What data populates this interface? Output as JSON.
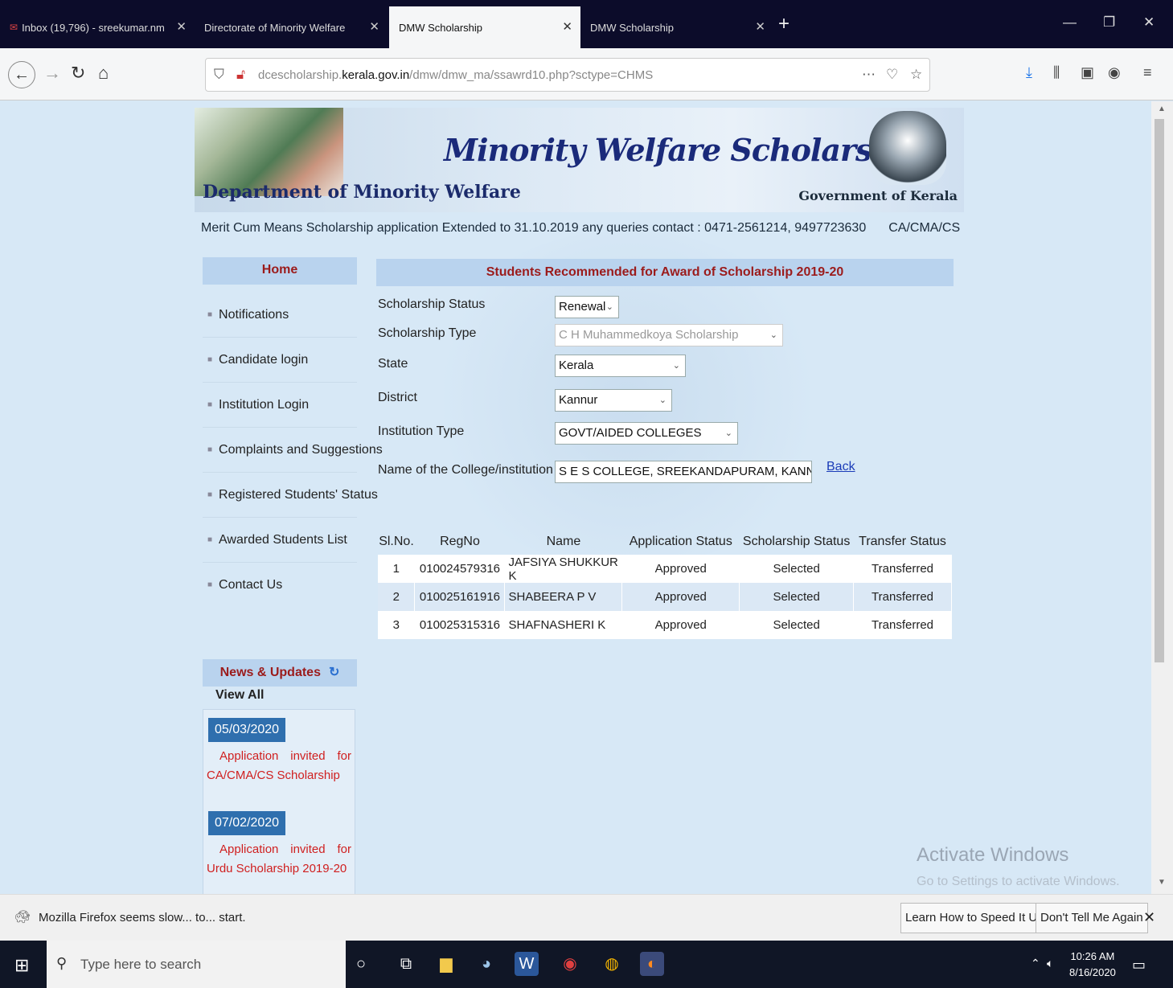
{
  "browser": {
    "tabs": [
      {
        "label": "Inbox (19,796) - sreekumar.nm",
        "active": false
      },
      {
        "label": "Directorate of Minority Welfare",
        "active": false
      },
      {
        "label": "DMW Scholarship",
        "active": true
      },
      {
        "label": "DMW Scholarship",
        "active": false
      }
    ],
    "url_prefix": "dcescholarship.",
    "url_domain": "kerala.gov.in",
    "url_path": "/dmw/dmw_ma/ssawrd10.php?sctype=CHMS"
  },
  "page": {
    "banner_title": "Minority Welfare Scholarships",
    "banner_dept": "Department of Minority Welfare",
    "banner_gov": "Government of Kerala",
    "marquee": [
      "Merit Cum Means Scholarship application Extended to 31.10.2019 any queries contact : 0471-2561214, 9497723630",
      "CA/CMA/CS Scholarship"
    ],
    "sidebar": {
      "home": "Home",
      "items": [
        "Notifications",
        "Candidate login",
        "Institution Login",
        "Complaints and Suggestions",
        "Registered Students' Status",
        "Awarded Students List",
        "Contact Us"
      ]
    },
    "news": {
      "heading": "News & Updates",
      "view_all": "View All",
      "items": [
        {
          "date": "05/03/2020",
          "text": "Application invited for CA/CMA/CS Scholarship"
        },
        {
          "date": "07/02/2020",
          "text": "Application invited for Urdu Scholarship 2019-20"
        }
      ]
    },
    "content_title": "Students Recommended for Award of Scholarship 2019-20",
    "form": {
      "scholarship_status": {
        "label": "Scholarship Status",
        "value": "Renewal"
      },
      "scholarship_type": {
        "label": "Scholarship Type",
        "value": "C H Muhammedkoya Scholarship"
      },
      "state": {
        "label": "State",
        "value": "Kerala"
      },
      "district": {
        "label": "District",
        "value": "Kannur"
      },
      "institution_type": {
        "label": "Institution Type",
        "value": "GOVT/AIDED COLLEGES"
      },
      "college": {
        "label": "Name of the College/institution",
        "value": "S E S COLLEGE, SREEKANDAPURAM, KANNUR"
      },
      "back": "Back"
    },
    "table": {
      "headers": [
        "Sl.No.",
        "RegNo",
        "Name",
        "Application Status",
        "Scholarship Status",
        "Transfer Status"
      ],
      "rows": [
        [
          "1",
          "010024579316",
          "JAFSIYA SHUKKUR K",
          "Approved",
          "Selected",
          "Transferred"
        ],
        [
          "2",
          "010025161916",
          "SHABEERA P V",
          "Approved",
          "Selected",
          "Transferred"
        ],
        [
          "3",
          "010025315316",
          "SHAFNASHERI K",
          "Approved",
          "Selected",
          "Transferred"
        ]
      ]
    },
    "activate_windows": "Activate Windows",
    "activate_windows_sub": "Go to Settings to activate Windows."
  },
  "notification": {
    "message": "Mozilla Firefox seems slow... to... start.",
    "btn_learn": "Learn How to Speed It Up",
    "btn_dont": "Don't Tell Me Again"
  },
  "taskbar": {
    "search_placeholder": "Type here to search",
    "time": "10:26 AM",
    "date": "8/16/2020"
  }
}
